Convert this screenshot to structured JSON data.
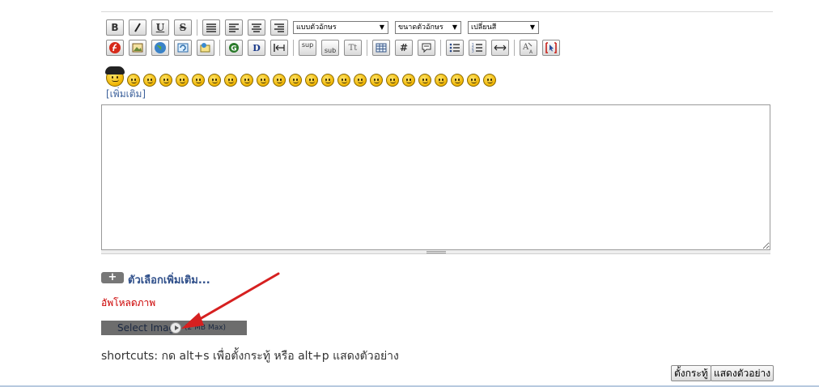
{
  "toolbar": {
    "bold": "B",
    "italic": "I",
    "underline": "U",
    "strike": "S",
    "sup": "sup",
    "sub": "sub",
    "tt": "Tt",
    "hash": "#",
    "font_select": "แบบตัวอักษร",
    "size_select": "ขนาดตัวอักษร",
    "color_select": "เปลี่ยนสี",
    "dropdown_arrow": "▼"
  },
  "smileys_more": "[เพิ่มเติม]",
  "more_options": {
    "plus": "+",
    "label": "ตัวเลือกเพิ่มเติม..."
  },
  "upload": {
    "title": "อัพโหลดภาพ",
    "button_label": "Select Imag",
    "max_size": "(2 MB Max)"
  },
  "shortcuts": "shortcuts: กด alt+s เพื่อตั้งกระทู้ หรือ alt+p แสดงตัวอย่าง",
  "buttons": {
    "submit": "ตั้งกระทู้",
    "preview": "แสดงตัวอย่าง"
  },
  "colors": {
    "upload_title": "#cc0000",
    "link": "#3a5f9a",
    "arrow": "#d62020"
  }
}
